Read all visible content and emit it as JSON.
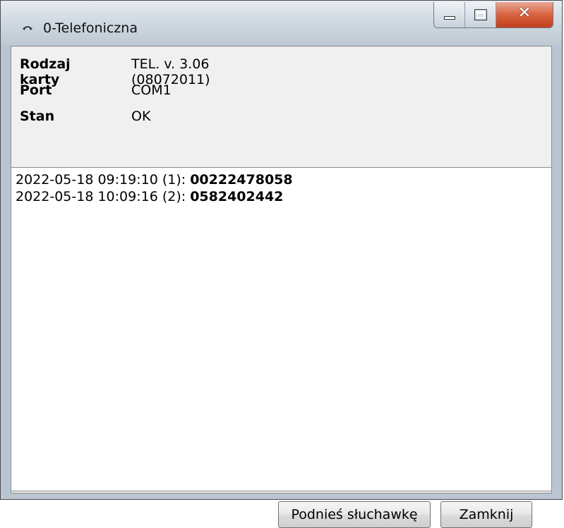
{
  "window": {
    "title": "0-Telefoniczna",
    "title_icon": "phone-icon"
  },
  "info": {
    "rows": [
      {
        "label": "Rodzaj karty",
        "value": "TEL. v. 3.06 (08072011)"
      },
      {
        "label": "Port",
        "value": "COM1"
      },
      {
        "label": "Stan",
        "value": "OK"
      }
    ]
  },
  "log": [
    {
      "prefix": "2022-05-18 09:19:10 (1): ",
      "number": "00222478058"
    },
    {
      "prefix": "2022-05-18 10:09:16 (2): ",
      "number": "0582402442"
    }
  ],
  "buttons": {
    "answer_label": "Podnieś słuchawkę",
    "close_label": "Zamknij"
  }
}
